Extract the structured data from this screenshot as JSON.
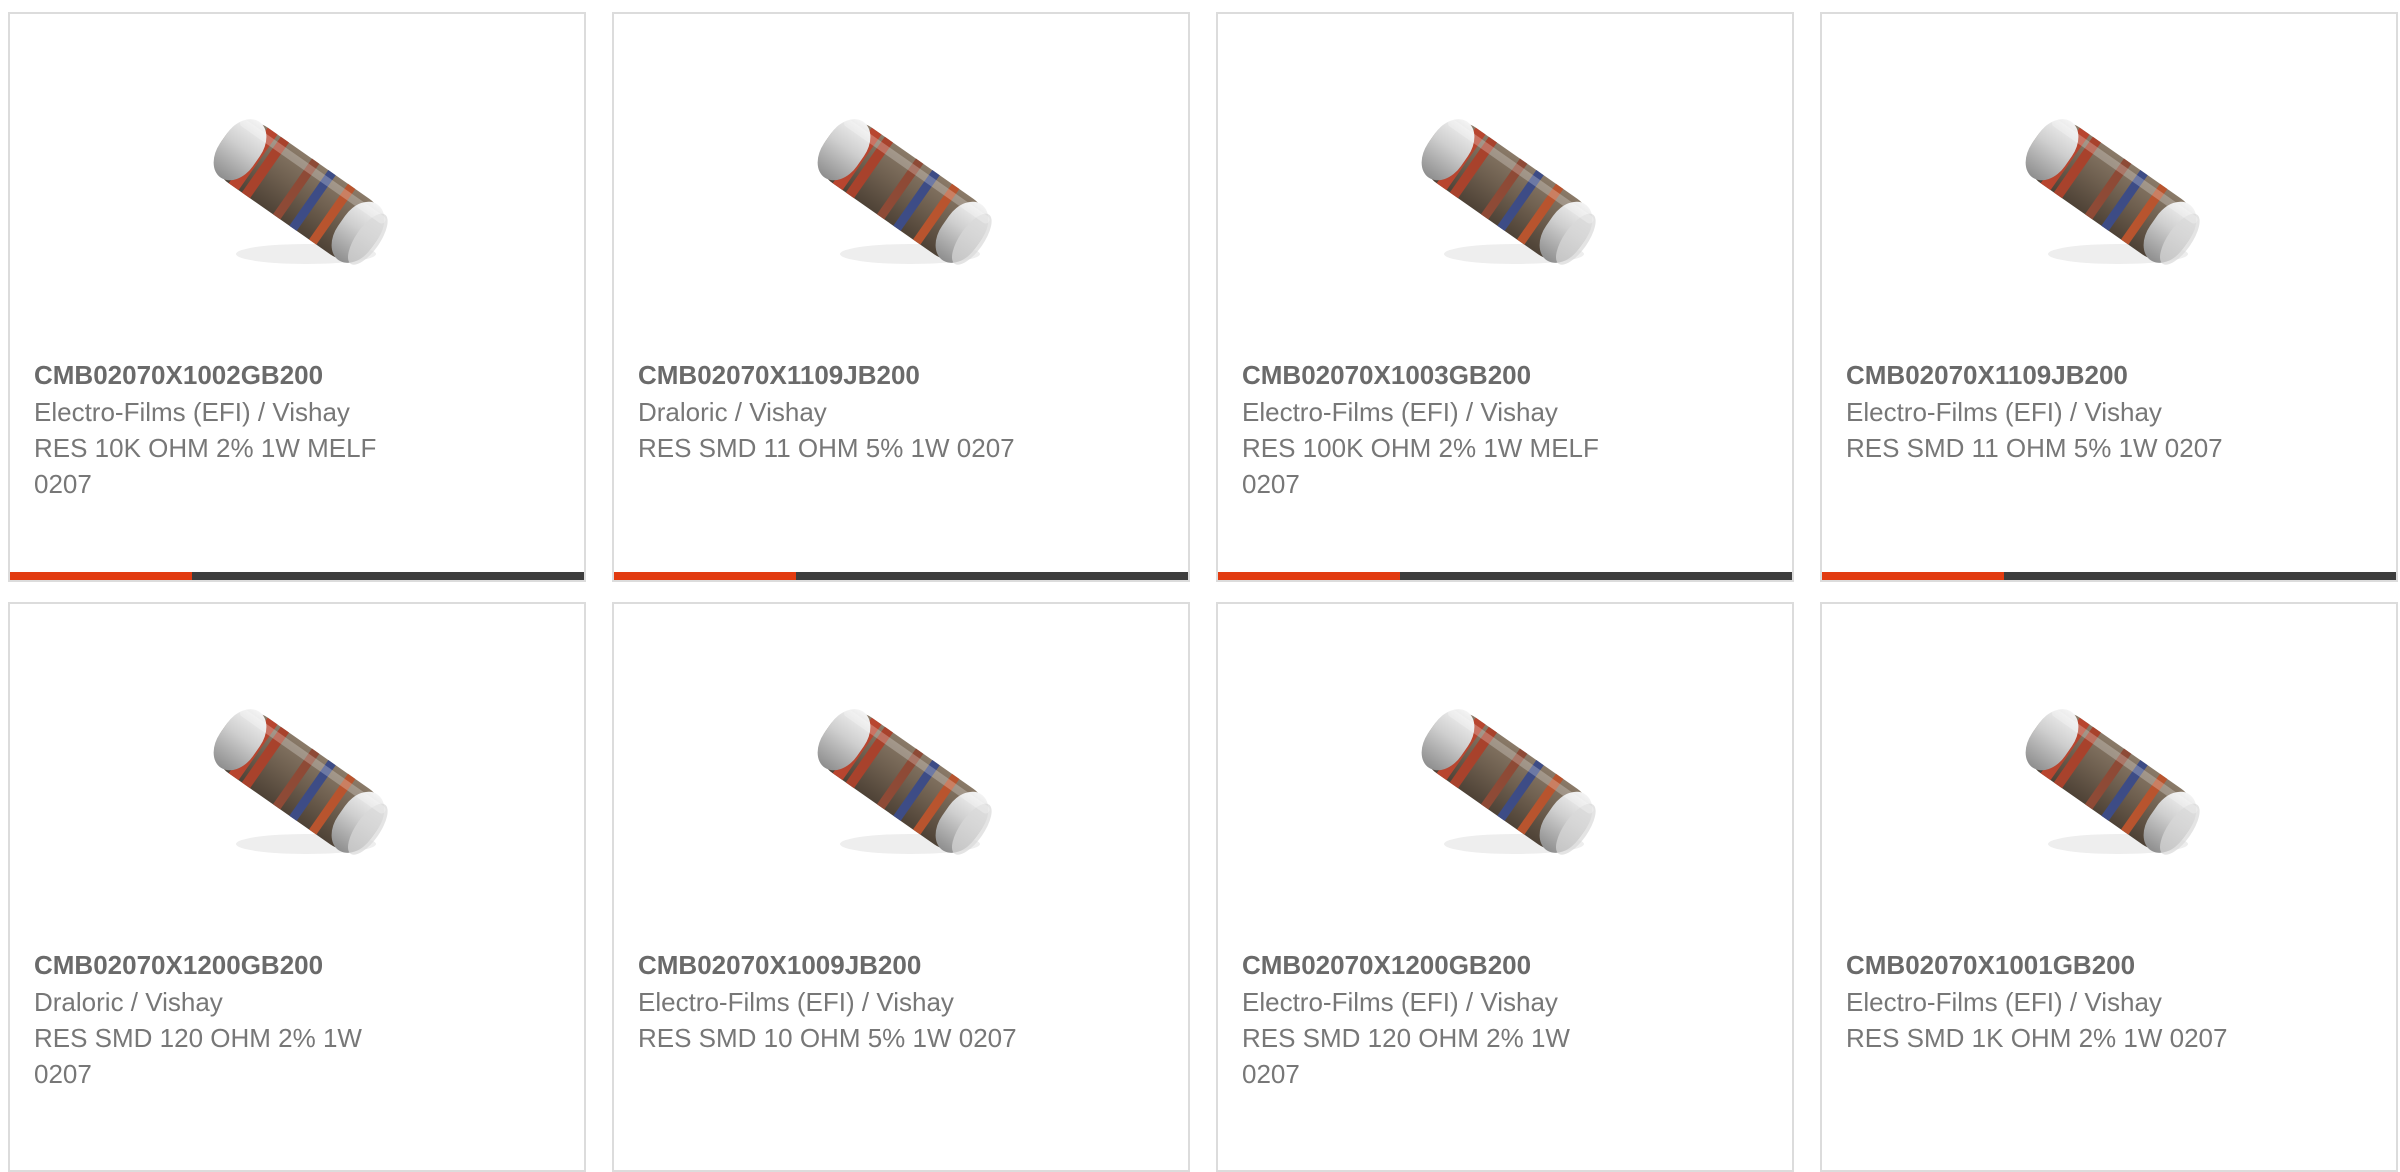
{
  "products": [
    {
      "part_number": "CMB02070X1002GB200",
      "manufacturer": "Electro-Films (EFI) / Vishay",
      "description": "RES 10K OHM 2% 1W MELF 0207",
      "show_bar": true
    },
    {
      "part_number": "CMB02070X1109JB200",
      "manufacturer": "Draloric / Vishay",
      "description": "RES SMD 11 OHM 5% 1W 0207",
      "show_bar": true
    },
    {
      "part_number": "CMB02070X1003GB200",
      "manufacturer": "Electro-Films (EFI) / Vishay",
      "description": "RES 100K OHM 2% 1W MELF 0207",
      "show_bar": true
    },
    {
      "part_number": "CMB02070X1109JB200",
      "manufacturer": "Electro-Films (EFI) / Vishay",
      "description": "RES SMD 11 OHM 5% 1W 0207",
      "show_bar": true
    },
    {
      "part_number": "CMB02070X1200GB200",
      "manufacturer": "Draloric / Vishay",
      "description": "RES SMD 120 OHM 2% 1W 0207",
      "show_bar": false
    },
    {
      "part_number": "CMB02070X1009JB200",
      "manufacturer": "Electro-Films (EFI) / Vishay",
      "description": "RES SMD 10 OHM 5% 1W 0207",
      "show_bar": false
    },
    {
      "part_number": "CMB02070X1200GB200",
      "manufacturer": "Electro-Films (EFI) / Vishay",
      "description": "RES SMD 120 OHM 2% 1W 0207",
      "show_bar": false
    },
    {
      "part_number": "CMB02070X1001GB200",
      "manufacturer": "Electro-Films (EFI) / Vishay",
      "description": "RES SMD 1K OHM 2% 1W 0207",
      "show_bar": false
    }
  ],
  "colors": {
    "accent": "#e23b10",
    "bar": "#3d3d3d",
    "border": "#dcdcdc",
    "text": "#777777"
  },
  "icons": {
    "product_image": "melf-resistor-image"
  }
}
